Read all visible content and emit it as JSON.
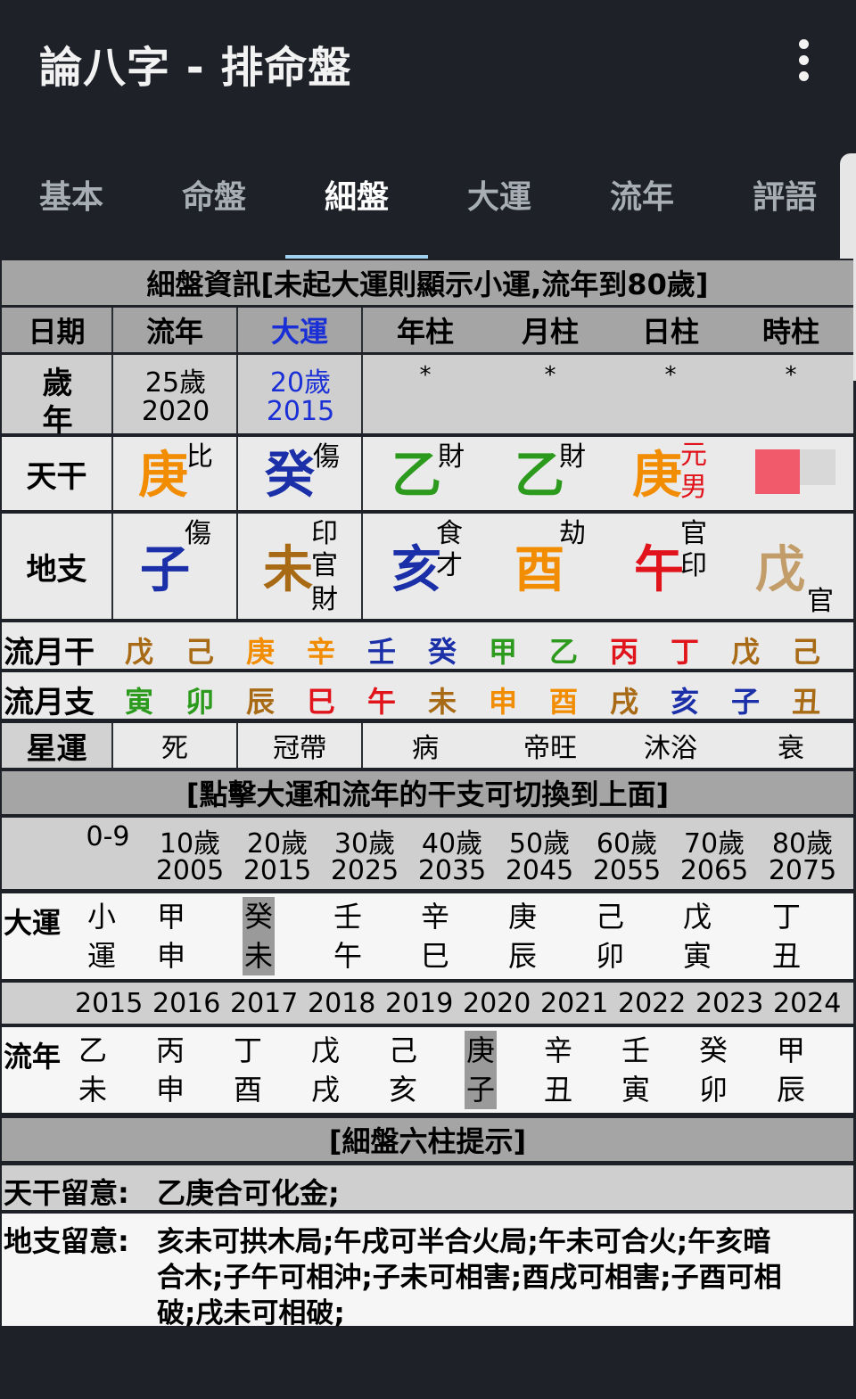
{
  "app": {
    "title": "論八字 - 排命盤",
    "menu_icon": "more-vert-icon"
  },
  "tabs": [
    {
      "label": "基本"
    },
    {
      "label": "命盤"
    },
    {
      "label": "細盤"
    },
    {
      "label": "大運"
    },
    {
      "label": "流年"
    },
    {
      "label": "評語"
    }
  ],
  "active_tab": "細盤",
  "section1": {
    "title": "細盤資訊[未起大運則顯示小運,流年到80歲]"
  },
  "columns": [
    "日期",
    "流年",
    "大運",
    "年柱",
    "月柱",
    "日柱",
    "時柱"
  ],
  "age_row": {
    "label_1": "歲",
    "label_2": "年",
    "liunian_age": "25歲",
    "liunian_year": "2020",
    "dayun_age": "20歲",
    "dayun_year": "2015",
    "stars": [
      "*",
      "*",
      "*",
      "*"
    ]
  },
  "tiangan": {
    "label": "天干",
    "cells": [
      {
        "char": "庚",
        "tags": [
          "比"
        ]
      },
      {
        "char": "癸",
        "tags": [
          "傷"
        ]
      },
      {
        "char": "乙",
        "tags": [
          "財"
        ]
      },
      {
        "char": "乙",
        "tags": [
          "財"
        ]
      },
      {
        "char": "庚",
        "tags": [
          "元",
          "男"
        ]
      }
    ]
  },
  "dizhi": {
    "label": "地支",
    "cells": [
      {
        "char": "子",
        "tags": [
          "傷"
        ]
      },
      {
        "char": "未",
        "tags": [
          "印",
          "官",
          "財"
        ]
      },
      {
        "char": "亥",
        "tags": [
          "食",
          "才"
        ]
      },
      {
        "char": "酉",
        "tags": [
          "劫"
        ]
      },
      {
        "char": "午",
        "tags": [
          "官",
          "印"
        ]
      },
      {
        "char": "戊",
        "tags": [
          "",
          "官"
        ]
      }
    ]
  },
  "liuyue_gan": {
    "label": "流月干",
    "chars": [
      "戊",
      "己",
      "庚",
      "辛",
      "壬",
      "癸",
      "甲",
      "乙",
      "丙",
      "丁",
      "戊",
      "己"
    ]
  },
  "liuyue_zhi": {
    "label": "流月支",
    "chars": [
      "寅",
      "卯",
      "辰",
      "巳",
      "午",
      "未",
      "申",
      "酉",
      "戌",
      "亥",
      "子",
      "丑"
    ]
  },
  "xingyun": {
    "label": "星運",
    "values": [
      "死",
      "冠帶",
      "病",
      "帝旺",
      "沐浴",
      "衰"
    ]
  },
  "section2": {
    "title": "[點擊大運和流年的干支可切換到上面]"
  },
  "dayun_header": [
    {
      "age": "0-9",
      "year": ""
    },
    {
      "age": "10歲",
      "year": "2005"
    },
    {
      "age": "20歲",
      "year": "2015"
    },
    {
      "age": "30歲",
      "year": "2025"
    },
    {
      "age": "40歲",
      "year": "2035"
    },
    {
      "age": "50歲",
      "year": "2045"
    },
    {
      "age": "60歲",
      "year": "2055"
    },
    {
      "age": "70歲",
      "year": "2065"
    },
    {
      "age": "80歲",
      "year": "2075"
    }
  ],
  "dayun": {
    "label": "大運",
    "items": [
      {
        "gan": "小",
        "zhi": "運"
      },
      {
        "gan": "甲",
        "zhi": "申"
      },
      {
        "gan": "癸",
        "zhi": "未"
      },
      {
        "gan": "壬",
        "zhi": "午"
      },
      {
        "gan": "辛",
        "zhi": "巳"
      },
      {
        "gan": "庚",
        "zhi": "辰"
      },
      {
        "gan": "己",
        "zhi": "卯"
      },
      {
        "gan": "戊",
        "zhi": "寅"
      },
      {
        "gan": "丁",
        "zhi": "丑"
      }
    ],
    "selected_index": 2
  },
  "liunian_years": [
    "2015",
    "2016",
    "2017",
    "2018",
    "2019",
    "2020",
    "2021",
    "2022",
    "2023",
    "2024"
  ],
  "liunian": {
    "label": "流年",
    "items": [
      {
        "gan": "乙",
        "zhi": "未"
      },
      {
        "gan": "丙",
        "zhi": "申"
      },
      {
        "gan": "丁",
        "zhi": "酉"
      },
      {
        "gan": "戊",
        "zhi": "戌"
      },
      {
        "gan": "己",
        "zhi": "亥"
      },
      {
        "gan": "庚",
        "zhi": "子"
      },
      {
        "gan": "辛",
        "zhi": "丑"
      },
      {
        "gan": "壬",
        "zhi": "寅"
      },
      {
        "gan": "癸",
        "zhi": "卯"
      },
      {
        "gan": "甲",
        "zhi": "辰"
      }
    ],
    "selected_index": 5
  },
  "section3": {
    "title": "[細盤六柱提示]"
  },
  "tips": {
    "tiangan_label": "天干留意:",
    "tiangan_text": "乙庚合可化金;",
    "dizhi_label": "地支留意:",
    "dizhi_line1": "亥未可拱木局;午戌可半合火局;午未可合火;午亥暗",
    "dizhi_line2": "合木;子午可相沖;子未可相害;酉戌可相害;子酉可相",
    "dizhi_line3": "破;戌未可相破;"
  }
}
